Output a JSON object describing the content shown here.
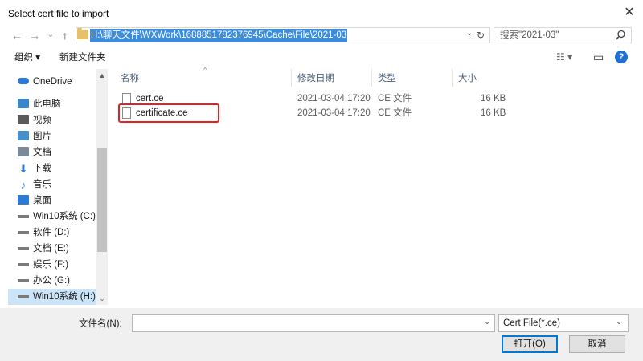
{
  "window": {
    "title": "Select cert file to import",
    "close_glyph": "✕"
  },
  "nav": {
    "back_glyph": "←",
    "forward_glyph": "→",
    "recent_glyph": "⌄",
    "up_glyph": "↑",
    "address": "H:\\聊天文件\\WXWork\\1688851782376945\\Cache\\File\\2021-03",
    "search_placeholder": "搜索\"2021-03\""
  },
  "toolbar": {
    "organize": "组织 ▾",
    "new_folder": "新建文件夹",
    "view_glyph": "☷ ▾",
    "pane_glyph": "▭",
    "help_glyph": "?"
  },
  "sidebar": {
    "items": [
      {
        "label": "OneDrive",
        "icon": "cloud-icon",
        "color": "#2b7bd6"
      },
      {
        "label": "此电脑",
        "icon": "computer-icon",
        "color": "#3a86c8"
      },
      {
        "label": "视频",
        "icon": "video-icon",
        "color": "#5b5b5b"
      },
      {
        "label": "图片",
        "icon": "picture-icon",
        "color": "#4a90c8"
      },
      {
        "label": "文档",
        "icon": "document-icon",
        "color": "#7a8a99"
      },
      {
        "label": "下载",
        "icon": "download-icon",
        "color": "#2b7bd6"
      },
      {
        "label": "音乐",
        "icon": "music-icon",
        "color": "#2b7bd6"
      },
      {
        "label": "桌面",
        "icon": "desktop-icon",
        "color": "#2b7bd6"
      },
      {
        "label": "Win10系统 (C:)",
        "icon": "drive-icon",
        "color": "#7a7a7a"
      },
      {
        "label": "软件 (D:)",
        "icon": "drive-icon",
        "color": "#7a7a7a"
      },
      {
        "label": "文档 (E:)",
        "icon": "drive-icon",
        "color": "#7a7a7a"
      },
      {
        "label": "娱乐 (F:)",
        "icon": "drive-icon",
        "color": "#7a7a7a"
      },
      {
        "label": "办公 (G:)",
        "icon": "drive-icon",
        "color": "#7a7a7a"
      },
      {
        "label": "Win10系统 (H:)",
        "icon": "drive-icon",
        "color": "#7a7a7a",
        "selected": true
      }
    ]
  },
  "columns": {
    "name": "名称",
    "date": "修改日期",
    "type": "类型",
    "size": "大小"
  },
  "files": [
    {
      "name": "cert.ce",
      "date": "2021-03-04 17:20",
      "type": "CE 文件",
      "size": "16 KB"
    },
    {
      "name": "certificate.ce",
      "date": "2021-03-04 17:20",
      "type": "CE 文件",
      "size": "16 KB",
      "highlighted": true
    }
  ],
  "footer": {
    "filename_label": "文件名(N):",
    "filename_value": "",
    "filetype": "Cert File(*.ce)",
    "open": "打开(O)",
    "cancel": "取消"
  },
  "colors": {
    "selection": "#3c8de0",
    "highlight_border": "#e02424",
    "help": "#1e6fd6"
  }
}
